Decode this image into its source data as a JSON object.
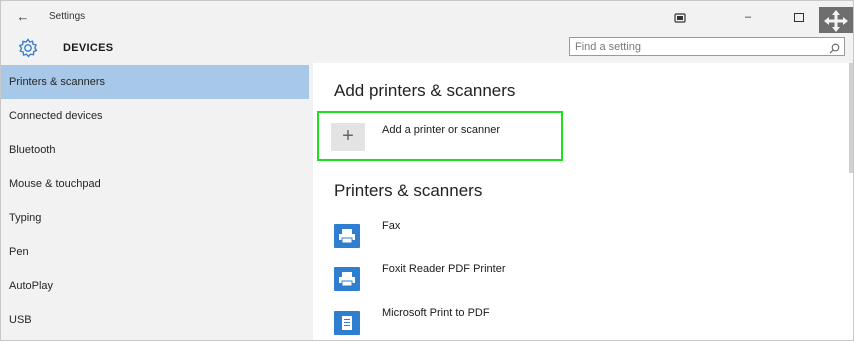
{
  "window": {
    "title": "Settings",
    "back_icon": "back-arrow-icon",
    "controls": {
      "tablet_icon": "tablet-mode-icon",
      "minimize": "–",
      "maximize_icon": "maximize-icon",
      "move_icon": "move-arrows-icon"
    }
  },
  "header": {
    "icon": "gear-icon",
    "title": "DEVICES",
    "search_placeholder": "Find a setting",
    "search_icon": "search-icon"
  },
  "sidebar": {
    "items": [
      {
        "label": "Printers & scanners",
        "active": true
      },
      {
        "label": "Connected devices",
        "active": false
      },
      {
        "label": "Bluetooth",
        "active": false
      },
      {
        "label": "Mouse & touchpad",
        "active": false
      },
      {
        "label": "Typing",
        "active": false
      },
      {
        "label": "Pen",
        "active": false
      },
      {
        "label": "AutoPlay",
        "active": false
      },
      {
        "label": "USB",
        "active": false
      }
    ]
  },
  "main": {
    "add_heading": "Add printers & scanners",
    "add_button_label": "Add a printer or scanner",
    "add_button_symbol": "+",
    "printers_heading": "Printers & scanners",
    "printers": [
      {
        "name": "Fax",
        "icon": "printer-icon"
      },
      {
        "name": "Foxit Reader PDF Printer",
        "icon": "printer-icon"
      },
      {
        "name": "Microsoft Print to PDF",
        "icon": "printer-icon"
      }
    ]
  },
  "colors": {
    "sidebar_bg": "#f2f2f2",
    "active_item_bg": "#a7c8e8",
    "highlight_border": "#1ee01e",
    "printer_icon_bg": "#2f7fd0"
  }
}
